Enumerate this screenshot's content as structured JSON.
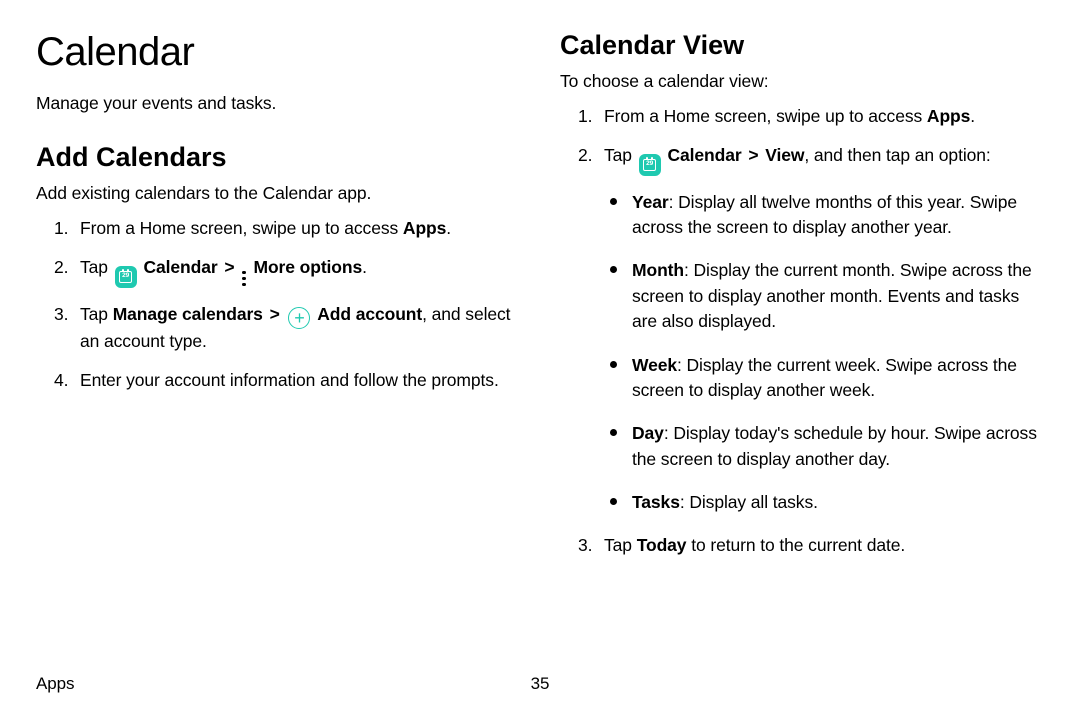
{
  "left": {
    "title": "Calendar",
    "intro": "Manage your events and tasks.",
    "section_title": "Add Calendars",
    "section_intro": "Add existing calendars to the Calendar app.",
    "step1_a": "From a Home screen, swipe up to access ",
    "step1_b": "Apps",
    "step1_c": ".",
    "step2_a": "Tap ",
    "step2_b": "Calendar",
    "step2_c": "More options",
    "step2_d": ".",
    "step3_a": "Tap ",
    "step3_b": "Manage calendars",
    "step3_c": "Add account",
    "step3_d": ", and select an account type.",
    "step4": "Enter your account information and follow the prompts."
  },
  "right": {
    "section_title": "Calendar View",
    "section_intro": "To choose a calendar view:",
    "step1_a": "From a Home screen, swipe up to access ",
    "step1_b": "Apps",
    "step1_c": ".",
    "step2_a": "Tap ",
    "step2_b": "Calendar",
    "step2_c": "View",
    "step2_d": ", and then tap an option:",
    "bullets": {
      "year_b": "Year",
      "year_t": ": Display all twelve months of this year. Swipe across the screen to display another year.",
      "month_b": "Month",
      "month_t": ": Display the current month. Swipe across the screen to display another month. Events and tasks are also displayed.",
      "week_b": "Week",
      "week_t": ": Display the current week. Swipe across the screen to display another week.",
      "day_b": "Day",
      "day_t": ": Display today's schedule by hour. Swipe across the screen to display another day.",
      "tasks_b": "Tasks",
      "tasks_t": ": Display all tasks."
    },
    "step3_a": "Tap ",
    "step3_b": "Today",
    "step3_c": " to return to the current date."
  },
  "footer": {
    "left": "Apps",
    "page": "35"
  },
  "icons": {
    "calendar_num": "29",
    "plus": "+",
    "chevron": ">"
  }
}
